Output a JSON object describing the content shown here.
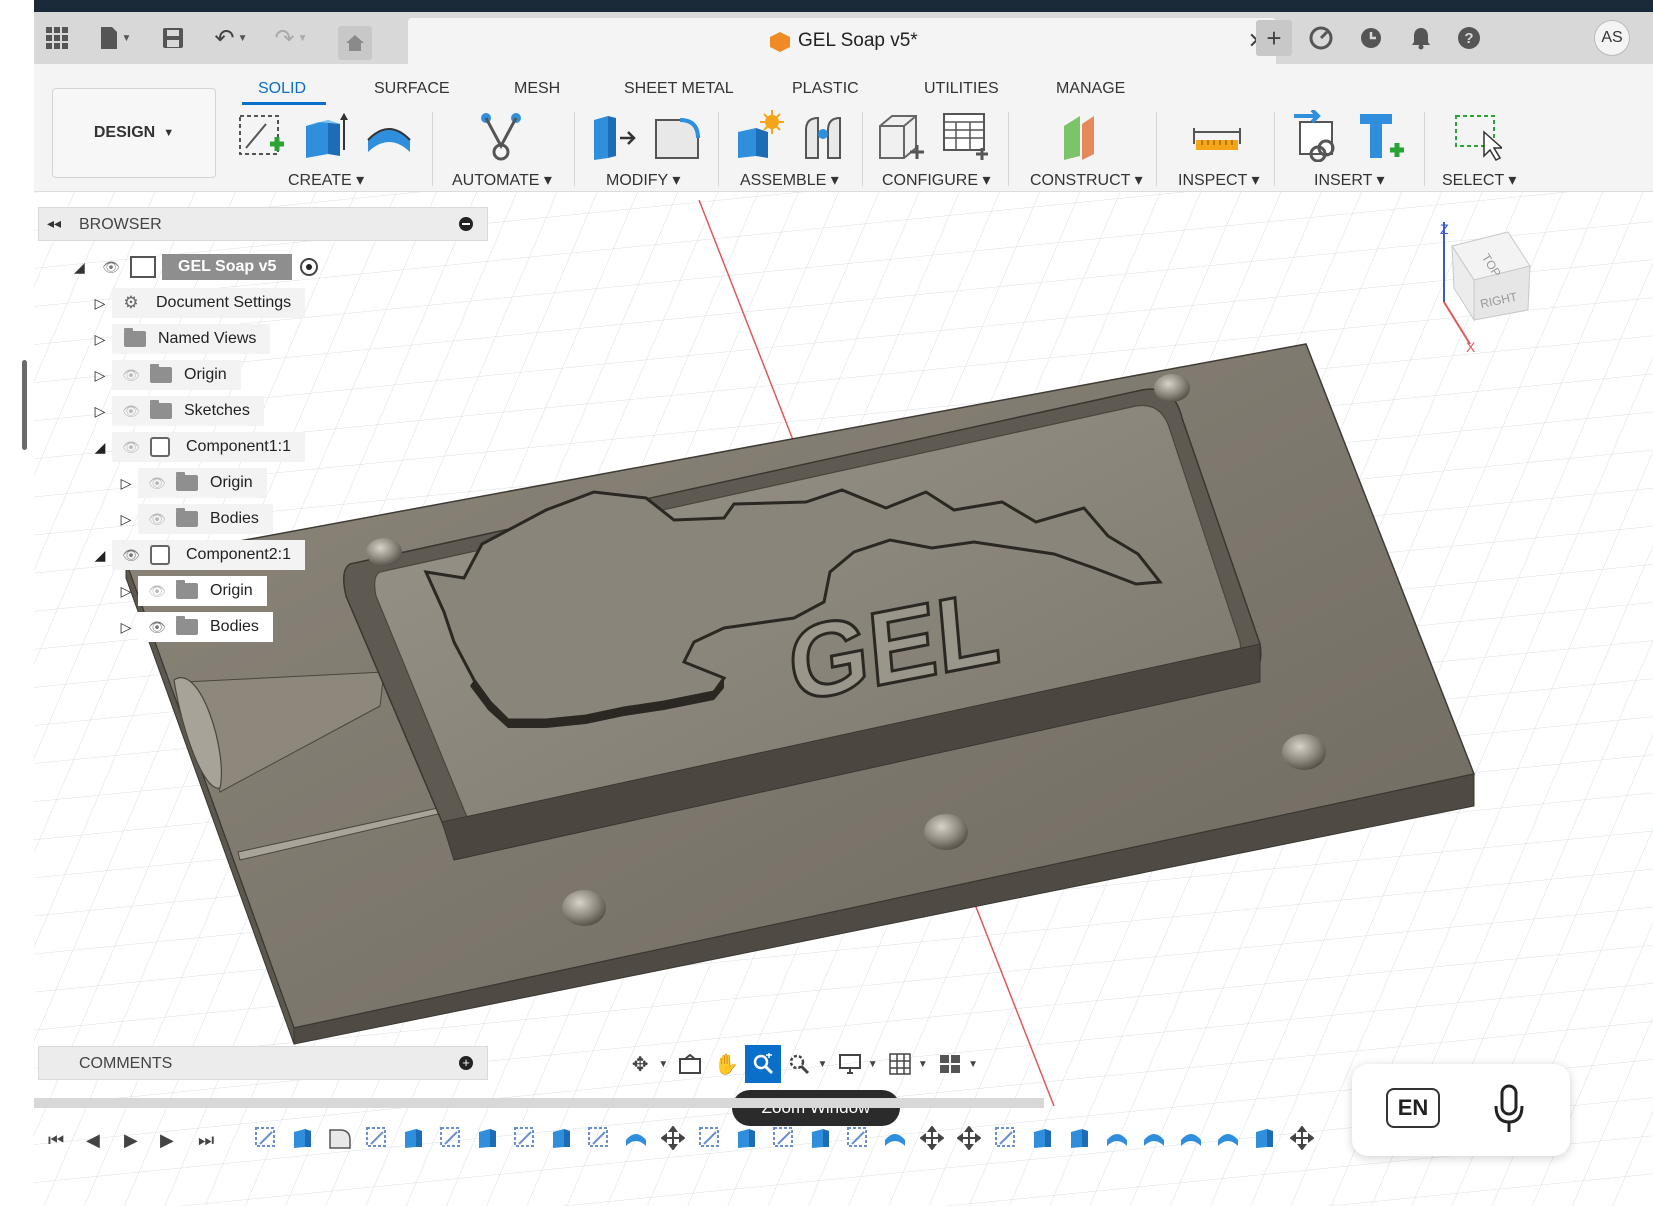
{
  "titlebar": {
    "document_title": "GEL Soap v5*",
    "user_initials": "AS"
  },
  "ribbon": {
    "workspace": "DESIGN",
    "tabs": [
      "SOLID",
      "SURFACE",
      "MESH",
      "SHEET METAL",
      "PLASTIC",
      "UTILITIES",
      "MANAGE"
    ],
    "active_tab": "SOLID",
    "groups": [
      "CREATE",
      "AUTOMATE",
      "MODIFY",
      "ASSEMBLE",
      "CONFIGURE",
      "CONSTRUCT",
      "INSPECT",
      "INSERT",
      "SELECT"
    ]
  },
  "browser": {
    "title": "BROWSER",
    "root": "GEL Soap v5",
    "items": [
      {
        "label": "Document Settings",
        "kind": "gear-icon",
        "visible": true
      },
      {
        "label": "Named Views",
        "kind": "folder-icon",
        "visible": true
      },
      {
        "label": "Origin",
        "kind": "folder-icon",
        "visible": false
      },
      {
        "label": "Sketches",
        "kind": "folder-icon",
        "visible": false
      },
      {
        "label": "Component1:1",
        "kind": "component-icon",
        "visible": false
      },
      {
        "label": "Origin",
        "kind": "folder-icon",
        "visible": false
      },
      {
        "label": "Bodies",
        "kind": "folder-icon",
        "visible": false
      },
      {
        "label": "Component2:1",
        "kind": "component-icon",
        "visible": true
      },
      {
        "label": "Origin",
        "kind": "folder-icon",
        "visible": false
      },
      {
        "label": "Bodies",
        "kind": "folder-icon",
        "visible": true
      }
    ]
  },
  "viewcube": {
    "top": "TOP",
    "right": "RIGHT",
    "axis_z": "Z",
    "axis_x": "X"
  },
  "model": {
    "emboss_text": "GEL"
  },
  "comments": {
    "title": "COMMENTS"
  },
  "tooltip": {
    "text": "Zoom Window"
  },
  "lang_widget": {
    "language": "EN"
  },
  "colors": {
    "accent": "#0a6fc8",
    "model_gray": "#7d776d",
    "model_dark": "#4a463f"
  }
}
